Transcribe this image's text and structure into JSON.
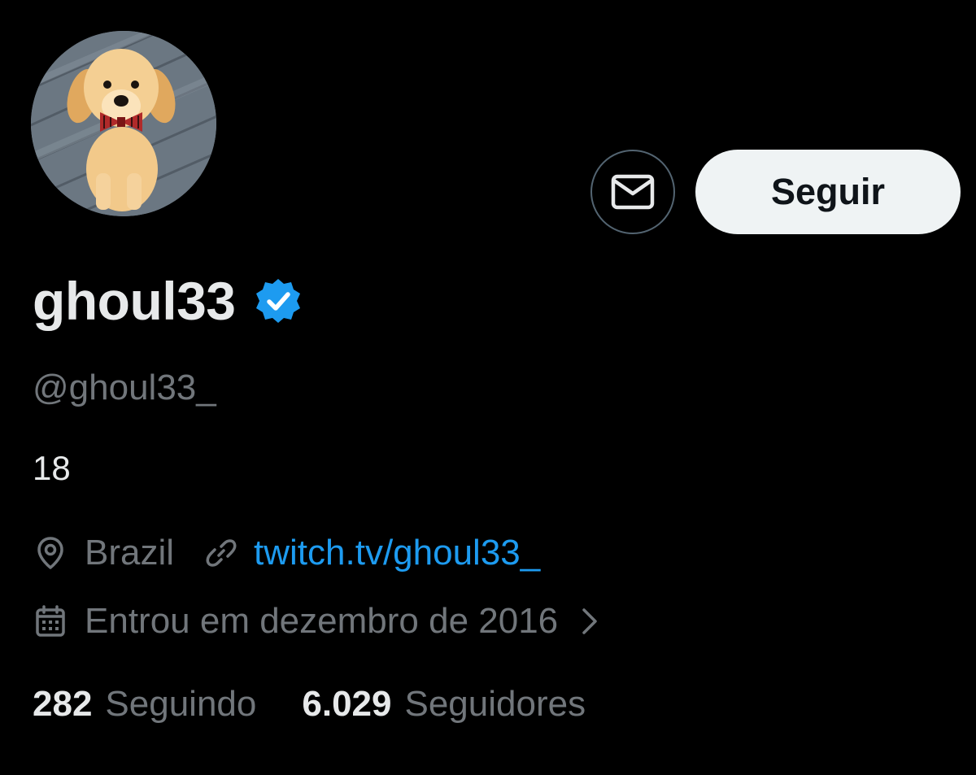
{
  "profile": {
    "display_name": "ghoul33",
    "handle": "@ghoul33_",
    "bio": "18",
    "location": "Brazil",
    "website": "twitch.tv/ghoul33_",
    "joined": "Entrou em dezembro de 2016",
    "verified": true,
    "avatar": "golden-retriever-puppy-with-bowtie"
  },
  "actions": {
    "message_icon": "envelope-icon",
    "follow_label": "Seguir"
  },
  "stats": {
    "following_count": "282",
    "following_label": "Seguindo",
    "followers_count": "6.029",
    "followers_label": "Seguidores"
  },
  "colors": {
    "background": "#000000",
    "primary_text": "#e7e9ea",
    "secondary_text": "#71767b",
    "link": "#1d9bf0",
    "verified_badge": "#1d9bf0",
    "follow_button_bg": "#eff3f4",
    "follow_button_text": "#0f1419",
    "border": "#536471"
  }
}
